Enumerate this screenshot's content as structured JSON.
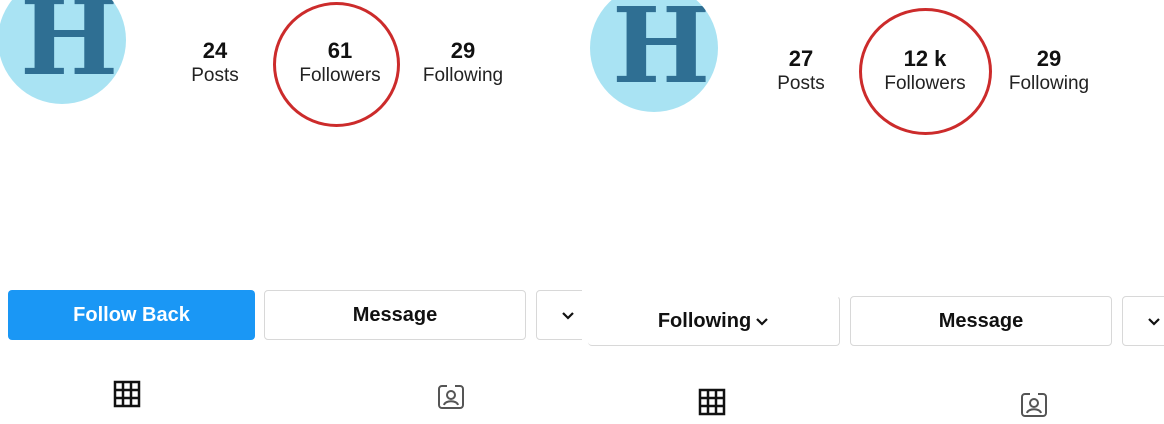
{
  "left": {
    "avatar_letter": "H",
    "posts": {
      "value": "24",
      "label": "Posts"
    },
    "followers": {
      "value": "61",
      "label": "Followers"
    },
    "following": {
      "value": "29",
      "label": "Following"
    },
    "buttons": {
      "follow_back": "Follow Back",
      "message": "Message"
    }
  },
  "right": {
    "avatar_letter": "H",
    "posts": {
      "value": "27",
      "label": "Posts"
    },
    "followers": {
      "value": "12 k",
      "label": "Followers"
    },
    "following": {
      "value": "29",
      "label": "Following"
    },
    "buttons": {
      "following": "Following",
      "message": "Message"
    }
  },
  "icons": {
    "grid": "grid-icon",
    "tagged": "tagged-photos-icon",
    "chevron": "chevron-down-icon"
  },
  "colors": {
    "primary_button": "#1a97f5",
    "highlight_circle": "#cc2b2b",
    "avatar_bg": "#a9e3f3",
    "avatar_letter": "#2f6f93"
  }
}
